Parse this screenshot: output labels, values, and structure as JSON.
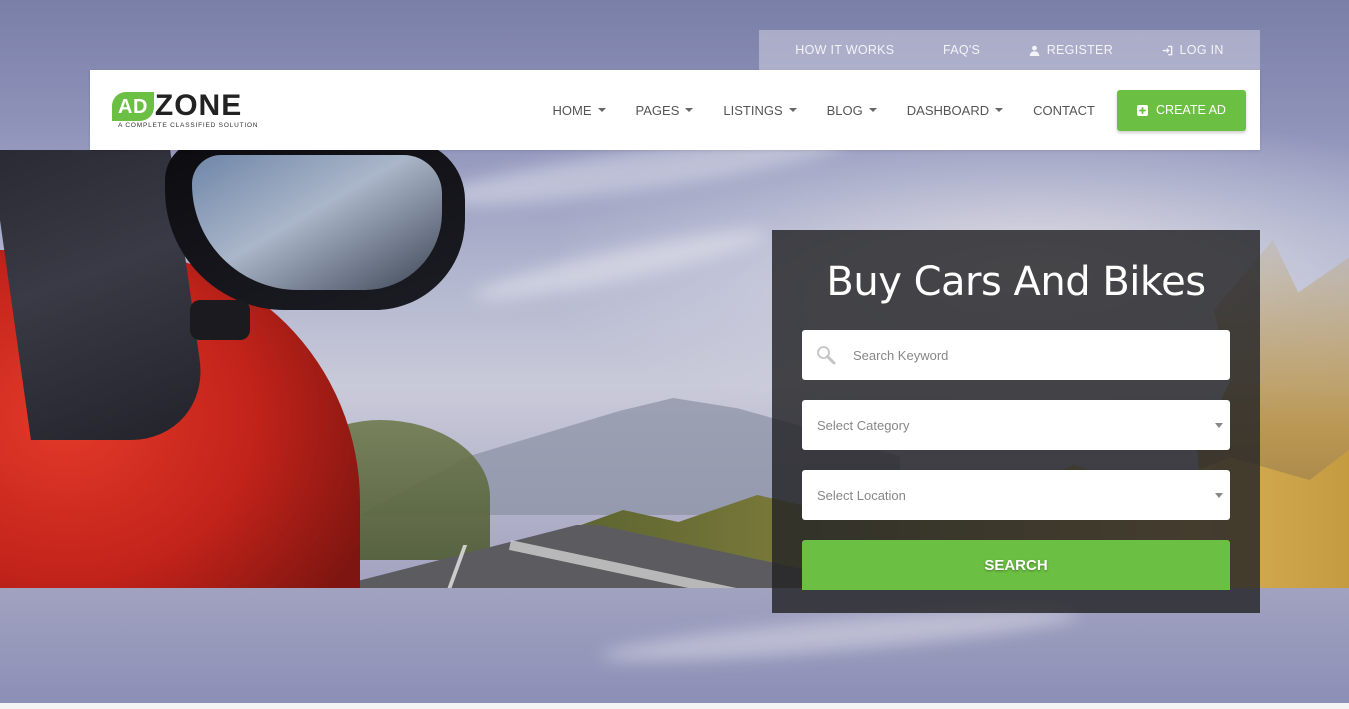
{
  "topbar": {
    "items": [
      {
        "label": "How It Works",
        "icon": ""
      },
      {
        "label": "FAQ's",
        "icon": ""
      },
      {
        "label": "Register",
        "icon": "user-icon"
      },
      {
        "label": "Log In",
        "icon": "sign-in-icon"
      }
    ]
  },
  "logo": {
    "ad": "AD",
    "zone": "ZONE",
    "tagline": "A Complete Classified Solution"
  },
  "nav": {
    "items": [
      {
        "label": "Home",
        "dropdown": true
      },
      {
        "label": "Pages",
        "dropdown": true
      },
      {
        "label": "Listings",
        "dropdown": true
      },
      {
        "label": "Blog",
        "dropdown": true
      },
      {
        "label": "Dashboard",
        "dropdown": true
      },
      {
        "label": "Contact",
        "dropdown": false
      }
    ],
    "create_ad": "Create Ad"
  },
  "search": {
    "title": "Buy Cars And Bikes",
    "keyword_placeholder": "Search Keyword",
    "category_placeholder": "Select Category",
    "location_placeholder": "Select Location",
    "button": "Search"
  },
  "colors": {
    "accent": "#6bbf42",
    "panel": "#232326"
  }
}
